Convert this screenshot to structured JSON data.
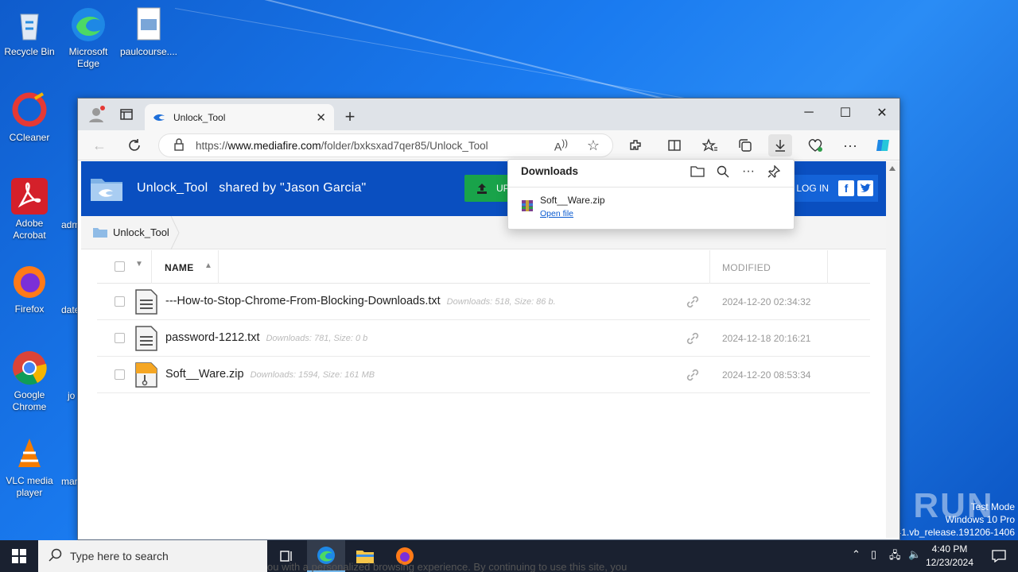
{
  "desktop": {
    "icons": [
      {
        "label": "Recycle Bin"
      },
      {
        "label": "Microsoft Edge"
      },
      {
        "label": "paulcourse...."
      },
      {
        "label": "CCleaner"
      },
      {
        "label": "Adobe Acrobat"
      },
      {
        "label": "Firefox"
      },
      {
        "label": "Google Chrome"
      },
      {
        "label": "VLC media player"
      }
    ],
    "partial_labels": [
      "adm",
      "date",
      "jo",
      "mar"
    ],
    "watermark": "ANY RUN",
    "test_mode": [
      "Test Mode",
      "Windows 10 Pro",
      "Build 19041.vb_release.191206-1406"
    ]
  },
  "browser": {
    "tab_title": "Unlock_Tool",
    "url_prefix": "https://",
    "url_domain": "www.mediafire.com",
    "url_path": "/folder/bxksxad7qer85/Unlock_Tool"
  },
  "page": {
    "folder_title": "Unlock_Tool   shared by \"Jason Garcia\"",
    "upload_label": "UP",
    "login_label": "LOG IN",
    "breadcrumb": "Unlock_Tool",
    "columns": {
      "name": "NAME",
      "modified": "MODIFIED"
    },
    "files": [
      {
        "name": "---How-to-Stop-Chrome-From-Blocking-Downloads.txt",
        "meta": "Downloads: 518, Size: 86 b.",
        "modified": "2024-12-20 02:34:32",
        "type": "txt"
      },
      {
        "name": "password-1212.txt",
        "meta": "Downloads: 781, Size: 0 b",
        "modified": "2024-12-18 20:16:21",
        "type": "txt"
      },
      {
        "name": "Soft__Ware.zip",
        "meta": "Downloads: 1594, Size: 161 MB",
        "modified": "2024-12-20 08:53:34",
        "type": "zip"
      }
    ]
  },
  "downloads": {
    "title": "Downloads",
    "file": "Soft__Ware.zip",
    "action": "Open file"
  },
  "taskbar": {
    "search_placeholder": "Type here to search",
    "time": "4:40 PM",
    "date": "12/23/2024",
    "banner_text": "ou with a personalized browsing experience. By continuing to use this site, you"
  },
  "colors": {
    "mediafire_blue": "#0a4fc0",
    "accent": "#0a5bd0"
  }
}
